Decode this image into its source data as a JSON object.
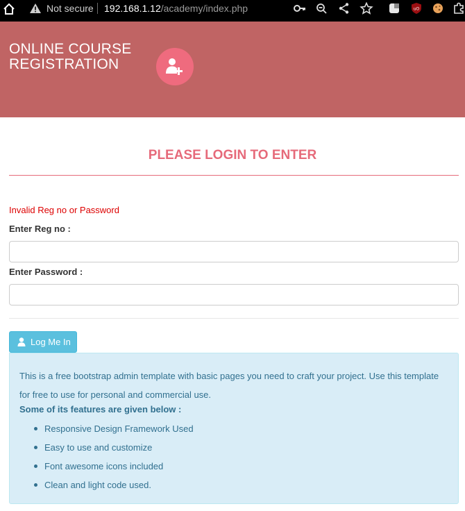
{
  "browser": {
    "not_secure": "Not secure",
    "url_host": "192.168.1.12",
    "url_path": "/academy/index.php",
    "icons": [
      "home-icon",
      "warning-icon",
      "key-icon",
      "zoom-icon",
      "share-icon",
      "star-icon",
      "extension-icon",
      "ublock-icon",
      "extension-cookie-icon",
      "puzzle-icon"
    ]
  },
  "header": {
    "title_line1": "ONLINE COURSE",
    "title_line2": "REGISTRATION",
    "logo_icon": "user-plus-icon",
    "band_color": "#c06464",
    "logo_color": "#ef6b7e"
  },
  "login": {
    "heading": "PLEASE LOGIN TO ENTER",
    "error": "Invalid Reg no or Password",
    "reg_label": "Enter Reg no :",
    "reg_value": "",
    "password_label": "Enter Password :",
    "password_value": "",
    "button_label": "Log Me In",
    "button_icon": "user-icon",
    "accent_color": "#e66a7a",
    "button_color": "#5bc0de"
  },
  "info": {
    "text": "This is a free bootstrap admin template with basic pages you need to craft your project. Use this template for free to use for personal and commercial use.",
    "features_heading": "Some of its features are given below :",
    "features": [
      "Responsive Design Framework Used",
      "Easy to use and customize",
      "Font awesome icons included",
      "Clean and light code used."
    ]
  }
}
